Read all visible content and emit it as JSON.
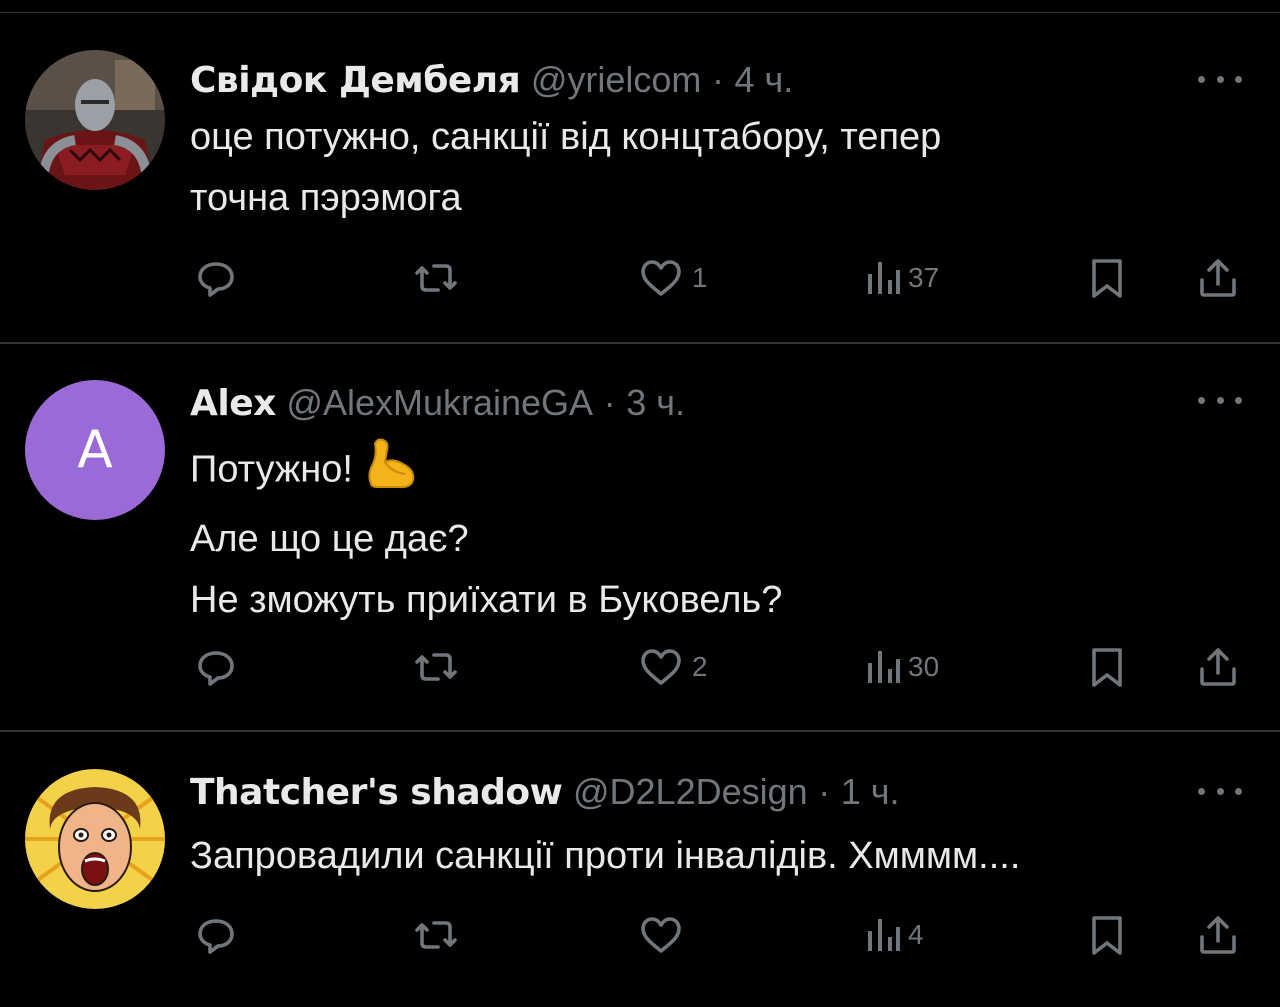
{
  "tweets": [
    {
      "name": "Свідок Дембеля",
      "handle": "@yrielcom",
      "separator": "·",
      "time": "4 ч.",
      "avatar_type": "knight-image",
      "lines": [
        "оце потужно, санкції від концтабору, тепер",
        "точна пэрэмога"
      ],
      "reply_count": "",
      "retweet_count": "",
      "like_count": "1",
      "view_count": "37"
    },
    {
      "name": "Alex",
      "handle": "@AlexMukraineGA",
      "separator": "·",
      "time": "3 ч.",
      "avatar_type": "letter",
      "avatar_letter": "A",
      "avatar_color": "#9a6bd6",
      "lines": [
        "Потужно!",
        "Але що це дає?",
        "Не зможуть приїхати в Буковель?"
      ],
      "emoji": "flexed-biceps-icon",
      "reply_count": "",
      "retweet_count": "",
      "like_count": "2",
      "view_count": "30"
    },
    {
      "name": "Thatcher's shadow",
      "handle": "@D2L2Design",
      "separator": "·",
      "time": "1 ч.",
      "avatar_type": "screaming-woman-comic",
      "lines": [
        "Запровадили санкції проти інвалідів. Хмммм...."
      ],
      "reply_count": "",
      "retweet_count": "",
      "like_count": "",
      "view_count": "4"
    }
  ],
  "icons": {
    "reply": "reply-bubble-icon",
    "retweet": "retweet-icon",
    "like": "heart-icon",
    "views": "views-bar-chart-icon",
    "bookmark": "bookmark-icon",
    "share": "share-icon",
    "more": "more-dots-icon"
  },
  "colors": {
    "background": "#000000",
    "text": "#e7e9ea",
    "muted": "#71767b",
    "divider": "#2f3336"
  }
}
